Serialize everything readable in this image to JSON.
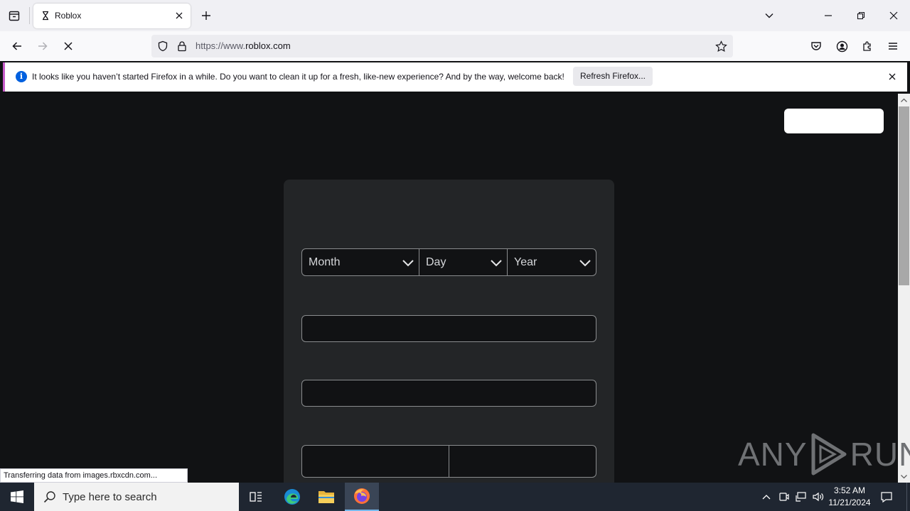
{
  "browser": {
    "tab": {
      "title": "Roblox",
      "favicon": "hourglass-loading-icon"
    },
    "url": {
      "prefix": "https://www.",
      "domain": "roblox.com"
    },
    "notification": {
      "message": "It looks like you haven’t started Firefox in a while. Do you want to clean it up for a fresh, like-new experience? And by the way, welcome back!",
      "action_label": "Refresh Firefox...",
      "accent_color": "#c65bc9"
    },
    "status_text": "Transferring data from images.rbxcdn.com..."
  },
  "page": {
    "background_color": "#111214",
    "card_color": "#232527",
    "birthday": {
      "month_placeholder": "Month",
      "day_placeholder": "Day",
      "year_placeholder": "Year"
    }
  },
  "watermark": {
    "left": "ANY",
    "right": "RUN"
  },
  "taskbar": {
    "search_placeholder": "Type here to search",
    "apps": [
      "task-view-icon",
      "edge-icon",
      "file-explorer-icon",
      "firefox-icon"
    ],
    "time": "3:52 AM",
    "date": "11/21/2024"
  }
}
